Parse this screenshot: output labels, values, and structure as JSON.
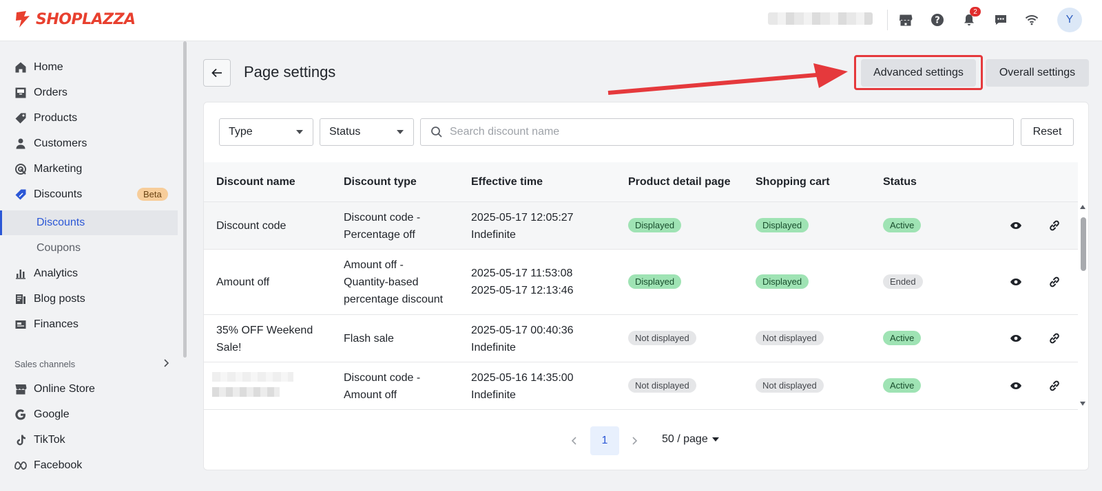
{
  "app": {
    "brand": "SHOPLAZZA",
    "notification_count": "2",
    "avatar_initial": "Y"
  },
  "sidebar": {
    "items": [
      {
        "label": "Home",
        "icon": "home-icon"
      },
      {
        "label": "Orders",
        "icon": "inbox-icon"
      },
      {
        "label": "Products",
        "icon": "tag-icon"
      },
      {
        "label": "Customers",
        "icon": "person-icon"
      },
      {
        "label": "Marketing",
        "icon": "target-icon"
      },
      {
        "label": "Discounts",
        "icon": "discount-icon",
        "badge": "Beta"
      }
    ],
    "sub_items": [
      {
        "label": "Discounts",
        "active": true
      },
      {
        "label": "Coupons",
        "active": false
      }
    ],
    "items2": [
      {
        "label": "Analytics",
        "icon": "bar-chart-icon"
      },
      {
        "label": "Blog posts",
        "icon": "blog-icon"
      },
      {
        "label": "Finances",
        "icon": "finance-icon"
      }
    ],
    "sales_channels_label": "Sales channels",
    "channels": [
      {
        "label": "Online Store",
        "icon": "store-icon"
      },
      {
        "label": "Google",
        "icon": "google-icon"
      },
      {
        "label": "TikTok",
        "icon": "tiktok-icon"
      },
      {
        "label": "Facebook",
        "icon": "meta-icon"
      }
    ]
  },
  "header": {
    "title": "Page settings",
    "advanced_settings": "Advanced settings",
    "overall_settings": "Overall settings"
  },
  "filters": {
    "type_label": "Type",
    "status_label": "Status",
    "search_placeholder": "Search discount name",
    "reset_label": "Reset"
  },
  "table": {
    "columns": [
      "Discount name",
      "Discount type",
      "Effective time",
      "Product detail page",
      "Shopping cart",
      "Status"
    ],
    "rows": [
      {
        "name": [
          "Discount code"
        ],
        "type": [
          "Discount code -",
          "Percentage off"
        ],
        "time": [
          "2025-05-17 12:05:27",
          "Indefinite"
        ],
        "pdp": "Displayed",
        "cart": "Displayed",
        "status": "Active"
      },
      {
        "name": [
          "Amount off"
        ],
        "type": [
          "Amount off -",
          "Quantity-based",
          "percentage discount"
        ],
        "time": [
          "2025-05-17 11:53:08",
          "2025-05-17 12:13:46"
        ],
        "pdp": "Displayed",
        "cart": "Displayed",
        "status": "Ended"
      },
      {
        "name": [
          "35% OFF Weekend",
          "Sale!"
        ],
        "type": [
          "Flash sale"
        ],
        "time": [
          "2025-05-17 00:40:36",
          "Indefinite"
        ],
        "pdp": "Not displayed",
        "cart": "Not displayed",
        "status": "Active"
      },
      {
        "name": [],
        "type": [
          "Discount code -",
          "Amount off"
        ],
        "time": [
          "2025-05-16 14:35:00",
          "Indefinite"
        ],
        "pdp": "Not displayed",
        "cart": "Not displayed",
        "status": "Active"
      }
    ]
  },
  "pagination": {
    "current_page": "1",
    "per_page": "50 / page"
  },
  "colors": {
    "brand": "#e8402f",
    "accent": "#2b57d6",
    "highlight": "#e5393c",
    "tag_green": "#9fe3b4"
  }
}
